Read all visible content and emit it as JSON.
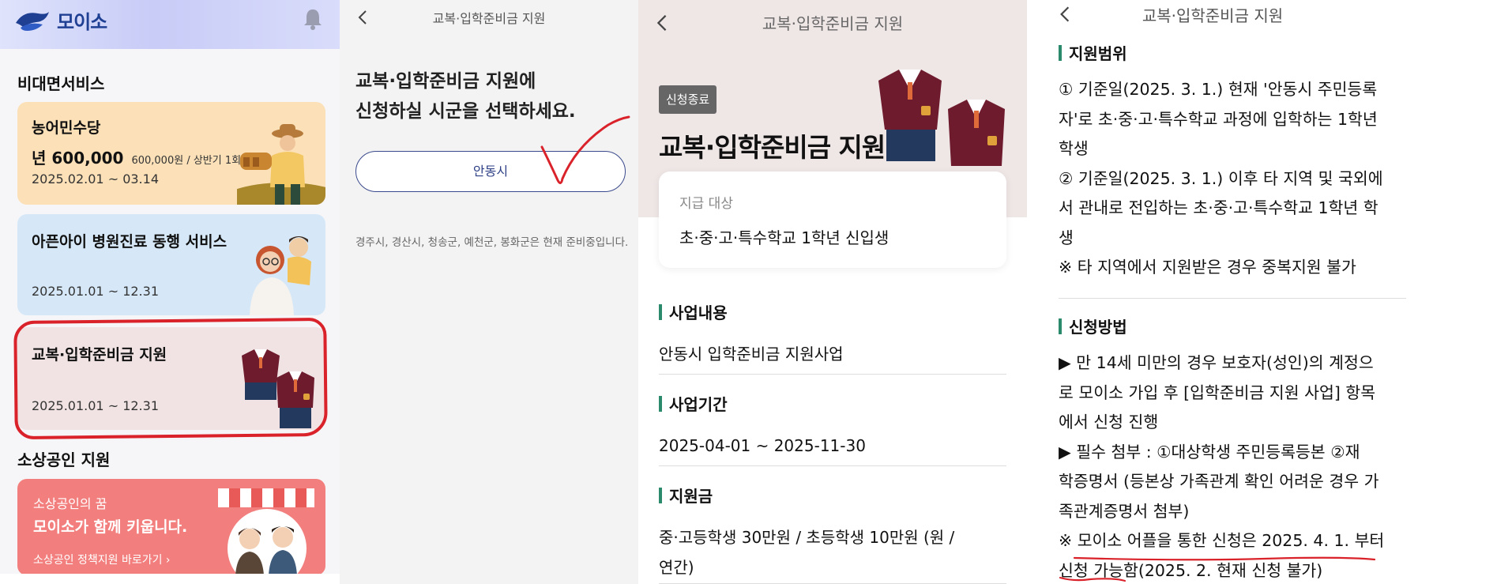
{
  "colors": {
    "brand_navy": "#1f3f93",
    "accent_green_bar": "#2c8a6c",
    "annotation_red": "#d9222a",
    "card_peach": "#fbe0b8",
    "card_blue": "#d6e8f8",
    "card_pink": "#f1e3e3",
    "promo_coral": "#f27f7d"
  },
  "home": {
    "logo_text": "모이소",
    "bell_icon": "bell-icon",
    "section_contactless": "비대면서비스",
    "cards": [
      {
        "title": "농어민수당",
        "amount_main": "년 600,000",
        "amount_note": "600,000원 / 상반기 1회",
        "date": "2025.02.01 ~ 03.14"
      },
      {
        "title": "아픈아이 병원진료 동행 서비스",
        "date": "2025.01.01 ~ 12.31"
      },
      {
        "title": "교복·입학준비금 지원",
        "date": "2025.01.01 ~ 12.31"
      }
    ],
    "section_small_business": "소상공인 지원",
    "promo": {
      "subtitle": "소상공인의 꿈",
      "title": "모이소가 함께 키웁니다.",
      "link": "소상공인 정책지원 바로가기 ›"
    }
  },
  "region_select": {
    "title": "교복·입학준비금 지원",
    "question_line1": "교복·입학준비금 지원에",
    "question_line2": "신청하실 시군을 선택하세요.",
    "region_button": "안동시",
    "note": "경주시, 경산시, 청송군, 예천군, 봉화군은 현재 준비중입니다."
  },
  "detail": {
    "title": "교복·입학준비금 지원",
    "status_badge": "신청종료",
    "hero_title": "교복·입학준비금 지원",
    "target_label": "지급 대상",
    "target_value": "초·중·고·특수학교 1학년 신입생",
    "sections": [
      {
        "heading": "사업내용",
        "body": "안동시 입학준비금 지원사업"
      },
      {
        "heading": "사업기간",
        "body": "2025-04-01 ~ 2025-11-30"
      },
      {
        "heading": "지원금",
        "body_line1": "중·고등학생 30만원 / 초등학생 10만원 (원 /",
        "body_line2": "연간)"
      }
    ]
  },
  "detail_more": {
    "title": "교복·입학준비금 지원",
    "scope_heading": "지원범위",
    "scope_lines": [
      "① 기준일(2025. 3. 1.) 현재 '안동시 주민등록",
      "자'로 초·중·고·특수학교 과정에 입학하는 1학년",
      "학생",
      "② 기준일(2025. 3. 1.) 이후 타 지역 및 국외에",
      "서 관내로 전입하는 초·중·고·특수학교 1학년 학",
      "생",
      "※ 타 지역에서 지원받은 경우 중복지원 불가"
    ],
    "method_heading": "신청방법",
    "method_lines": [
      "▶ 만 14세 미만의 경우 보호자(성인)의 계정으",
      "로 모이소 가입 후 [입학준비금 지원 사업] 항목",
      "에서 신청 진행",
      "▶ 필수 첨부 : ①대상학생 주민등록등본  ②재",
      "학증명서 (등본상 가족관계 확인 어려운 경우 가",
      "족관계증명서 첨부)",
      "※ 모이소 어플을 통한 신청은 2025. 4. 1. 부터",
      "신청 가능함(2025.  2. 현재 신청 불가)"
    ]
  }
}
